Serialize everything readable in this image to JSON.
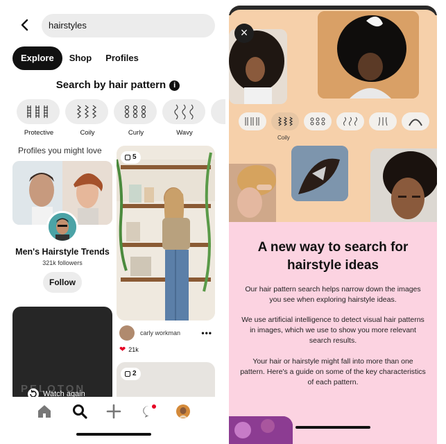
{
  "left": {
    "search": {
      "value": "hairstyles"
    },
    "tabs": [
      {
        "label": "Explore",
        "active": true
      },
      {
        "label": "Shop",
        "active": false
      },
      {
        "label": "Profiles",
        "active": false
      }
    ],
    "search_by_heading": "Search by hair pattern",
    "info_icon": "i",
    "patterns": [
      {
        "label": "Protective",
        "icon": "braids-icon"
      },
      {
        "label": "Coily",
        "icon": "coily-icon"
      },
      {
        "label": "Curly",
        "icon": "curly-icon"
      },
      {
        "label": "Wavy",
        "icon": "wavy-icon"
      }
    ],
    "profiles_heading": "Profiles you might love",
    "profile": {
      "name": "Men's Hairstyle Trends",
      "followers": "321k followers",
      "follow_label": "Follow"
    },
    "video_card": {
      "brand": "PELOTON",
      "watch_label": "Watch again"
    },
    "pin": {
      "count": "5",
      "author": "carly workman",
      "more": "•••",
      "likes": "21k"
    },
    "pin2": {
      "count": "2"
    },
    "nav": [
      "home-icon",
      "search-icon",
      "plus-icon",
      "chat-icon",
      "profile-avatar"
    ],
    "colors": {
      "accent_red": "#e60023",
      "active_tab_bg": "#111111"
    }
  },
  "right": {
    "close_label": "×",
    "chips": [
      {
        "icon": "braids-icon",
        "selected": false
      },
      {
        "icon": "coily-icon",
        "selected": true
      },
      {
        "icon": "curly-icon",
        "selected": false
      },
      {
        "icon": "wavy-icon",
        "selected": false
      },
      {
        "icon": "straight-icon",
        "selected": false
      },
      {
        "icon": "bald-icon",
        "selected": false
      }
    ],
    "selected_label": "Coily",
    "title": "A new way to search for hairstyle ideas",
    "paragraphs": [
      "Our hair pattern search helps narrow down the images you see when exploring hairstyle ideas.",
      "We use artificial intelligence to detect visual hair patterns in images, which we use to show you more relevant search results.",
      "Your hair or hairstyle might fall into more than one pattern. Here's a guide on some of the key characteristics of each pattern."
    ],
    "colors": {
      "peach": "#f6d0aa",
      "pink": "#fcd3e1"
    }
  }
}
